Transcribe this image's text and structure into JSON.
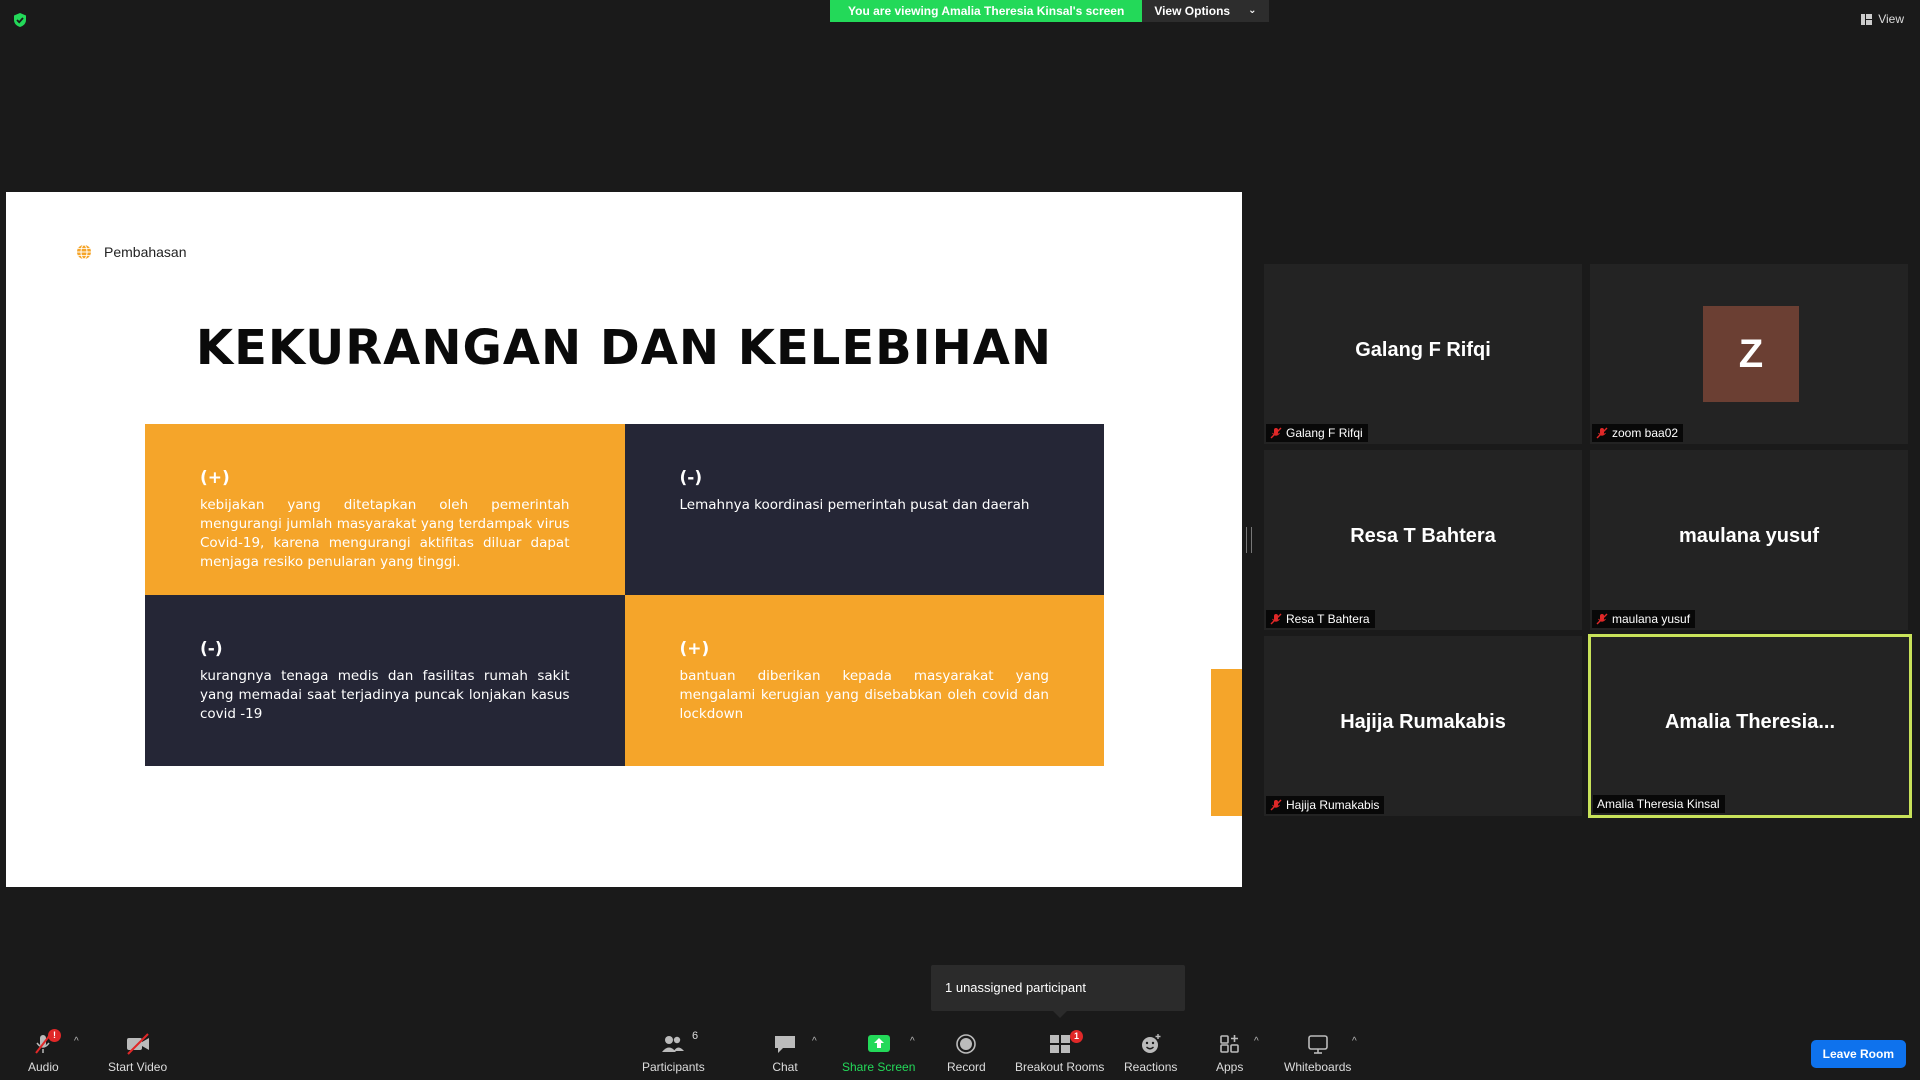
{
  "banner": {
    "viewing_text": "You are viewing Amalia Theresia Kinsal's screen",
    "view_options_label": "View Options"
  },
  "top_right": {
    "view_label": "View"
  },
  "slide": {
    "header_label": "Pembahasan",
    "title": "KEKURANGAN DAN KELEBIHAN",
    "cells": [
      {
        "sign": "(+)",
        "text": "kebijakan yang ditetapkan oleh pemerintah mengurangi jumlah masyarakat yang terdampak virus Covid-19, karena mengurangi aktifitas diluar dapat menjaga resiko penularan yang tinggi."
      },
      {
        "sign": "(-)",
        "text": "Lemahnya koordinasi pemerintah pusat dan daerah"
      },
      {
        "sign": "(-)",
        "text": "kurangnya tenaga medis dan fasilitas rumah sakit yang memadai saat terjadinya puncak lonjakan kasus covid -19"
      },
      {
        "sign": "(+)",
        "text": "bantuan diberikan  kepada masyarakat yang mengalami kerugian yang disebabkan oleh covid dan lockdown"
      }
    ],
    "accent_color": "#f5a52a",
    "dark_color": "#252636"
  },
  "participants": [
    {
      "display_name": "Galang F Rifqi",
      "label": "Galang F Rifqi",
      "muted": true
    },
    {
      "display_name": "Z",
      "label": "zoom baa02",
      "muted": true,
      "avatar_color": "#6b3f33"
    },
    {
      "display_name": "Resa T Bahtera",
      "label": "Resa T Bahtera",
      "muted": true
    },
    {
      "display_name": "maulana yusuf",
      "label": "maulana yusuf",
      "muted": true
    },
    {
      "display_name": "Hajija Rumakabis",
      "label": "Hajija Rumakabis",
      "muted": true
    },
    {
      "display_name": "Amalia  Theresia...",
      "label": "Amalia Theresia Kinsal",
      "muted": false,
      "active_speaker": true
    }
  ],
  "tooltip": {
    "text": "1 unassigned participant"
  },
  "toolbar": {
    "audio": "Audio",
    "audio_badge": "!",
    "start_video": "Start Video",
    "participants": "Participants",
    "participants_count": "6",
    "chat": "Chat",
    "share_screen": "Share Screen",
    "record": "Record",
    "breakout_rooms": "Breakout Rooms",
    "breakout_badge": "1",
    "reactions": "Reactions",
    "apps": "Apps",
    "whiteboards": "Whiteboards",
    "leave": "Leave Room"
  }
}
